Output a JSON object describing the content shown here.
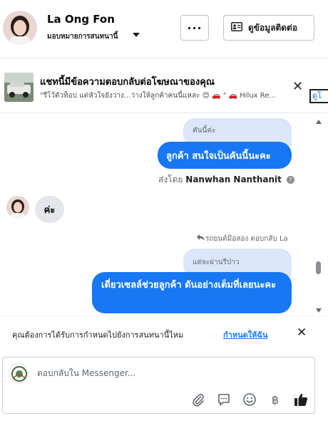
{
  "header": {
    "contact_name": "La Ong Fon",
    "assign_label": "มอบหมายการสนทนานี้",
    "more_label": "···",
    "contact_info_label": "ดูข้อมูลติดต่อ"
  },
  "ad_banner": {
    "title": "แชทนี้มีข้อความตอบกลับต่อโฆษณาของคุณ",
    "subtitle": "\"รีโว้ตัวท็อป แต่หัวใจยังว่าง...ว่างให้ลูกค้าคนนี้แหละ 😍 🚗 \" 🚗 Hilux Re...",
    "close_label": "✕",
    "link_label": "ดูโ"
  },
  "messages": {
    "quote1": "คันนี้ค่ะ",
    "bubble1": "ลูกค้า สนใจเป็นคันนี้นะคะ",
    "sent_by_prefix": "ส่งโดย",
    "sent_by_name": "Nanwhan Nanthanit",
    "incoming1": "ค่ะ",
    "reply_note": "รถยนต์มือสอง ตอบกลับ La",
    "quote2": "แต่จะผ่านรีป่าว",
    "bubble3": "เดี่ยวเซลล์ช่วยลูกค้า ดันอย่างเต็มที่เลยนะคะ"
  },
  "notice": {
    "text": "คุณต้องการได้รับการกำหนดไปยังการสนทนานี้ไหม",
    "link": "กำหนดให้ฉัน",
    "close": "✕"
  },
  "composer": {
    "placeholder": "ตอบกลับใน Messenger...",
    "currency_symbol": "฿"
  },
  "colors": {
    "accent": "#1877f2",
    "quote_bg": "#dbe6fb",
    "incoming_bg": "#e4e6eb"
  }
}
